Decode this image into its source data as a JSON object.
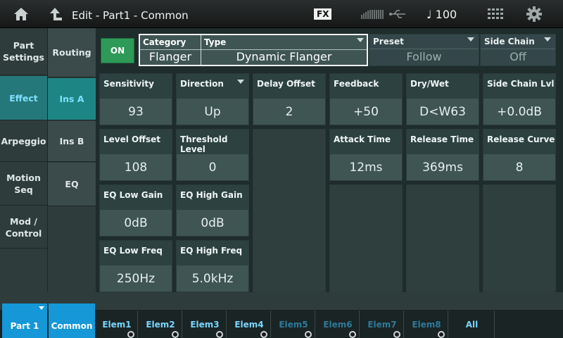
{
  "header": {
    "title": "Edit - Part1 - Common",
    "fx_badge": "FX",
    "tempo": "♩ 100"
  },
  "left_tabs": [
    {
      "label": "Part\nSettings"
    },
    {
      "label": "Effect"
    },
    {
      "label": "Arpeggio"
    },
    {
      "label": "Motion\nSeq"
    },
    {
      "label": "Mod /\nControl"
    }
  ],
  "sub_tabs": [
    {
      "label": "Routing"
    },
    {
      "label": "Ins A"
    },
    {
      "label": "Ins B"
    },
    {
      "label": "EQ"
    }
  ],
  "effect": {
    "on_label": "ON",
    "category_label": "Category",
    "category_value": "Flanger",
    "type_label": "Type",
    "type_value": "Dynamic Flanger",
    "preset_label": "Preset",
    "preset_value": "Follow",
    "sidechain_label": "Side Chain",
    "sidechain_value": "Off"
  },
  "params": [
    {
      "label": "Sensitivity",
      "value": "93"
    },
    {
      "label": "Direction",
      "value": "Up"
    },
    {
      "label": "Delay Offset",
      "value": "2"
    },
    {
      "label": "Feedback",
      "value": "+50"
    },
    {
      "label": "Dry/Wet",
      "value": "D<W63"
    },
    {
      "label": "Side Chain Lvl",
      "value": "+0.0dB"
    },
    {
      "label": "Level Offset",
      "value": "108"
    },
    {
      "label": "Threshold Level",
      "value": "0"
    },
    {
      "label": "Attack Time",
      "value": "12ms"
    },
    {
      "label": "Release Time",
      "value": "369ms"
    },
    {
      "label": "Release Curve",
      "value": "8"
    },
    {
      "label": "EQ Low Gain",
      "value": "0dB"
    },
    {
      "label": "EQ High Gain",
      "value": "0dB"
    },
    {
      "label": "EQ Low Freq",
      "value": "250Hz"
    },
    {
      "label": "EQ High Freq",
      "value": "5.0kHz"
    }
  ],
  "bottom": {
    "part_label": "Part 1",
    "common_label": "Common",
    "elements": [
      "Elem1",
      "Elem2",
      "Elem3",
      "Elem4",
      "Elem5",
      "Elem6",
      "Elem7",
      "Elem8",
      "All"
    ]
  }
}
